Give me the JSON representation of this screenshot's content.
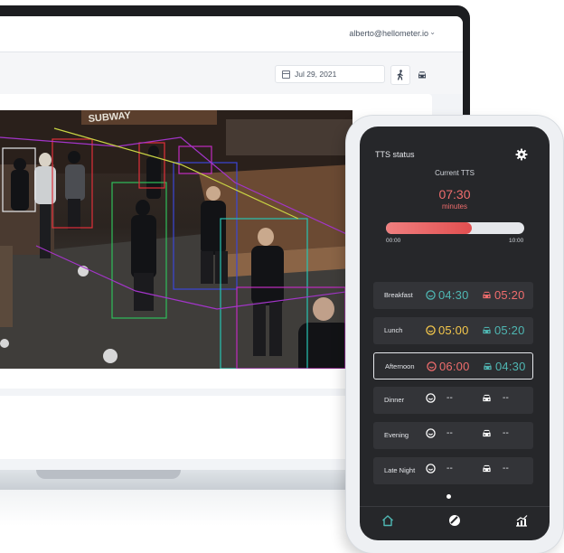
{
  "colors": {
    "accent_red": "#f06d6d",
    "accent_teal": "#4fb7b3",
    "accent_yellow": "#f5c84c",
    "phone_bg": "#26272a"
  },
  "dashboard": {
    "user_email": "alberto@hellometer.io",
    "date": "Jul 29, 2021",
    "icons": [
      "calendar-icon",
      "walk-icon",
      "car-icon",
      "chevron-down-icon"
    ]
  },
  "video_feed": {
    "store_sign": "SUBWAY"
  },
  "phone": {
    "title": "TTS status",
    "current_label": "Current TTS",
    "current_value": "07:30",
    "current_unit": "minutes",
    "progress_fraction": 0.62,
    "scale_min": "00:00",
    "scale_max": "10:00",
    "rows": [
      {
        "label": "Breakfast",
        "walk": "04:30",
        "walk_color": "#4fb7b3",
        "car": "05:20",
        "car_color": "#f06d6d",
        "active": false
      },
      {
        "label": "Lunch",
        "walk": "05:00",
        "walk_color": "#f5c84c",
        "car": "05:20",
        "car_color": "#4fb7b3",
        "active": false
      },
      {
        "label": "Afternoon",
        "walk": "06:00",
        "walk_color": "#f06d6d",
        "car": "04:30",
        "car_color": "#4fb7b3",
        "active": true
      },
      {
        "label": "Dinner",
        "walk": "--",
        "walk_color": "#e5e7eb",
        "car": "--",
        "car_color": "#e5e7eb",
        "active": false
      },
      {
        "label": "Evening",
        "walk": "--",
        "walk_color": "#e5e7eb",
        "car": "--",
        "car_color": "#e5e7eb",
        "active": false
      },
      {
        "label": "Late Night",
        "walk": "--",
        "walk_color": "#e5e7eb",
        "car": "--",
        "car_color": "#e5e7eb",
        "active": false
      }
    ],
    "nav": [
      "home-icon",
      "food-icon",
      "chart-icon"
    ]
  }
}
